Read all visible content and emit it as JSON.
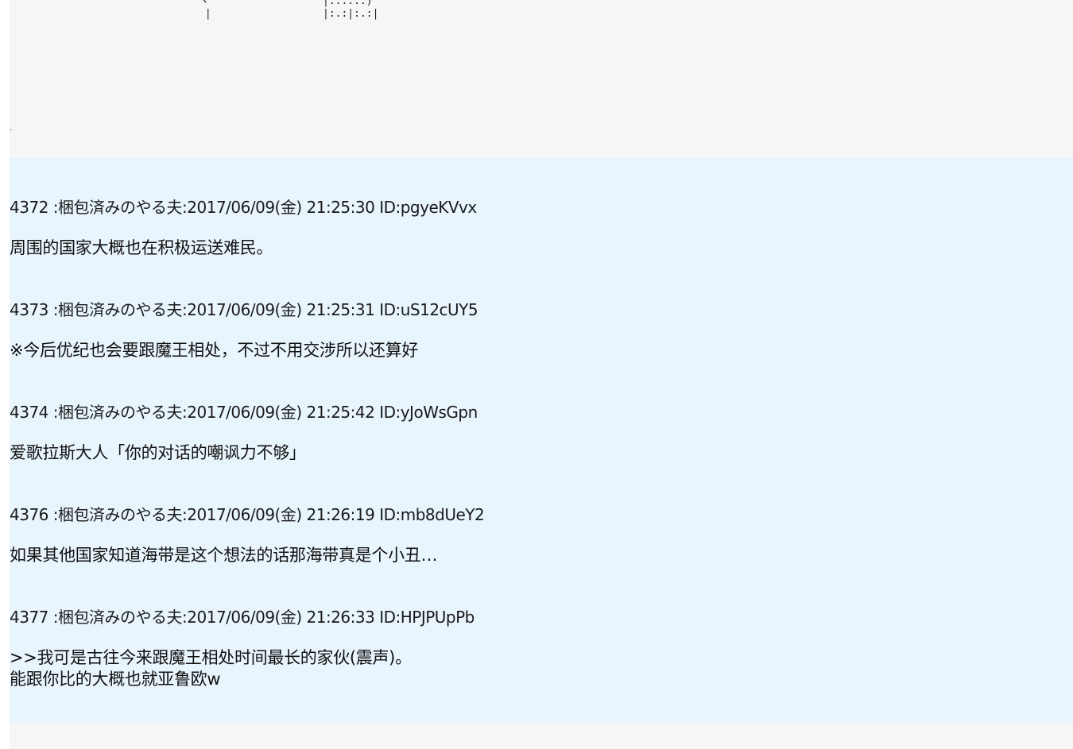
{
  "top_fragment": {
    "left_lines": [
      "ヽ",
      " |"
    ],
    "right_lines": [
      "|:.:.:.)",
      "|:.:|:.:|"
    ],
    "dot": "."
  },
  "posts": [
    {
      "number": "4372",
      "name": "梱包済みのやる夫",
      "date": "2017/06/09(金) 21:25:30",
      "id": "ID:pgyeKVvx",
      "body": "周围的国家大概也在积极运送难民。"
    },
    {
      "number": "4373",
      "name": "梱包済みのやる夫",
      "date": "2017/06/09(金) 21:25:31",
      "id": "ID:uS12cUY5",
      "body": "※今后优纪也会要跟魔王相处，不过不用交涉所以还算好"
    },
    {
      "number": "4374",
      "name": "梱包済みのやる夫",
      "date": "2017/06/09(金) 21:25:42",
      "id": "ID:yJoWsGpn",
      "body": "爱歌拉斯大人「你的对话的嘲讽力不够」"
    },
    {
      "number": "4376",
      "name": "梱包済みのやる夫",
      "date": "2017/06/09(金) 21:26:19",
      "id": "ID:mb8dUeY2",
      "body": "如果其他国家知道海带是这个想法的话那海带真是个小丑…"
    },
    {
      "number": "4377",
      "name": "梱包済みのやる夫",
      "date": "2017/06/09(金) 21:26:33",
      "id": "ID:HPJPUpPb",
      "body": ">>我可是古往今来跟魔王相处时间最长的家伙(震声)。\n能跟你比的大概也就亚鲁欧w"
    }
  ]
}
